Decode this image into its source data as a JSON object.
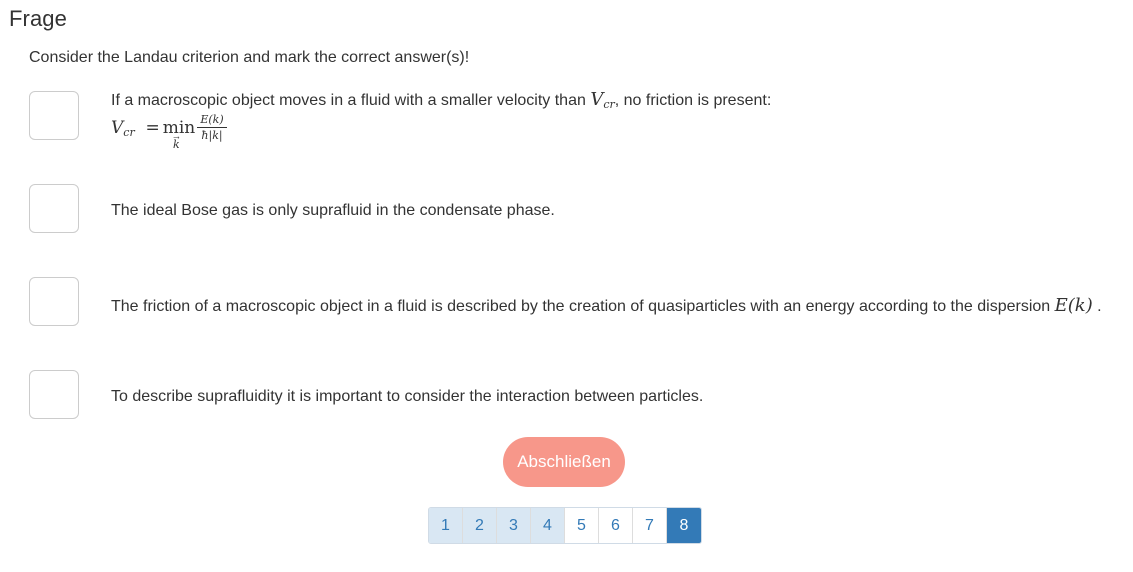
{
  "header": {
    "title": "Frage"
  },
  "question": {
    "text": "Consider the Landau criterion and mark the correct answer(s)!"
  },
  "options": [
    {
      "text_before": "If a macroscopic object moves in a fluid with a smaller velocity than",
      "math_var": "V",
      "math_sub": "cr",
      "text_after": ", no friction is present:",
      "formula": {
        "lhs_var": "V",
        "lhs_sub": "cr",
        "equals": "=",
        "operator": "min",
        "operator_under": "k",
        "numerator": "E(k)",
        "denominator": "ħ|k|"
      }
    },
    {
      "text": "The ideal Bose gas is only suprafluid in the condensate phase."
    },
    {
      "text_before": "The friction of a macroscopic object in a fluid is described by the creation of quasiparticles with an energy according to the dispersion",
      "math": "E(k)",
      "text_after": "."
    },
    {
      "text": "To describe suprafluidity it is important to consider the interaction between particles."
    }
  ],
  "actions": {
    "submit_label": "Abschließen"
  },
  "pagination": {
    "pages": [
      "1",
      "2",
      "3",
      "4",
      "5",
      "6",
      "7",
      "8"
    ],
    "visited": [
      "1",
      "2",
      "3",
      "4"
    ],
    "active": "8"
  },
  "colors": {
    "submit_background": "#f7978a",
    "pagination_active": "#337ab7",
    "pagination_visited": "#d9e7f3"
  }
}
